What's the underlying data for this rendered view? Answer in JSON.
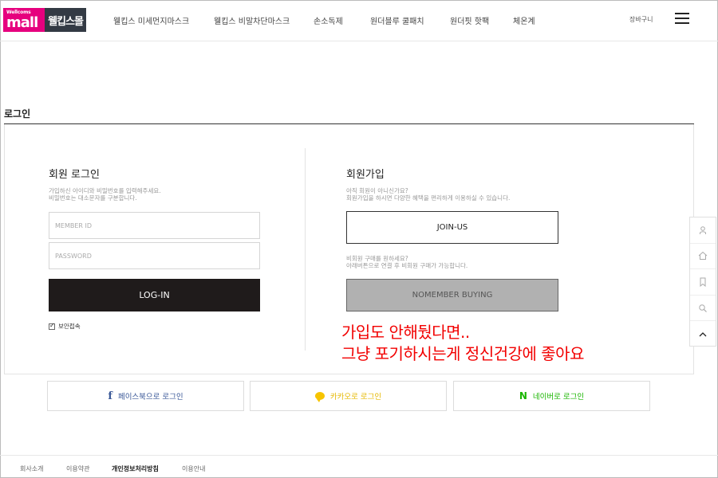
{
  "header": {
    "logo_small": "Wellcoms",
    "logo_big": "mall",
    "logo_name": "웰킵스몰",
    "nav": [
      "웰킵스 미세먼지마스크",
      "웰킵스 비말차단마스크",
      "손소독제",
      "원더블루 쿨패치",
      "원더핏 핫팩",
      "체온계"
    ],
    "cart": "장바구니"
  },
  "page": {
    "title": "로그인"
  },
  "member_login": {
    "title": "회원 로그인",
    "desc1": "가입하신 아이디와 비밀번호를 입력해주세요.",
    "desc2": "비밀번호는 대소문자를 구분합니다.",
    "id_placeholder": "MEMBER ID",
    "pw_placeholder": "PASSWORD",
    "login_button": "LOG-IN",
    "secure_label": "보안접속"
  },
  "join": {
    "title": "회원가입",
    "desc1": "아직 회원이 아니신가요?",
    "desc2": "회원가입을 하시면 다양한 혜택을 편리하게 이용하실 수 있습니다.",
    "join_button": "JOIN-US",
    "nomember_desc1": "비회원 구매를 원하세요?",
    "nomember_desc2": "아래버튼으로 연결 후 비회원 구매가 가능합니다.",
    "nomember_button": "NOMEMBER BUYING"
  },
  "overlay": {
    "line1": "가입도 안해뒀다면..",
    "line2": "그냥 포기하시는게 정신건강에 좋아요",
    "color": "#f20000"
  },
  "social": {
    "facebook": {
      "icon": "f",
      "label": "페이스북으로 로그인",
      "color": "#3b5998"
    },
    "kakao": {
      "label": "카카오로 로그인",
      "color": "#e6b800"
    },
    "naver": {
      "icon": "N",
      "label": "네이버로 로그인",
      "color": "#19b500"
    }
  },
  "quick_menu": [
    "user-icon",
    "home-icon",
    "bookmark-icon",
    "search-icon",
    "chevron-up-icon"
  ],
  "footer": {
    "links": [
      "회사소개",
      "이용약관",
      "개인정보처리방침",
      "이용안내"
    ]
  },
  "colors": {
    "brand_pink": "#e6007e",
    "dark": "#1f1b1b",
    "gray_button": "#b1b1b1"
  }
}
